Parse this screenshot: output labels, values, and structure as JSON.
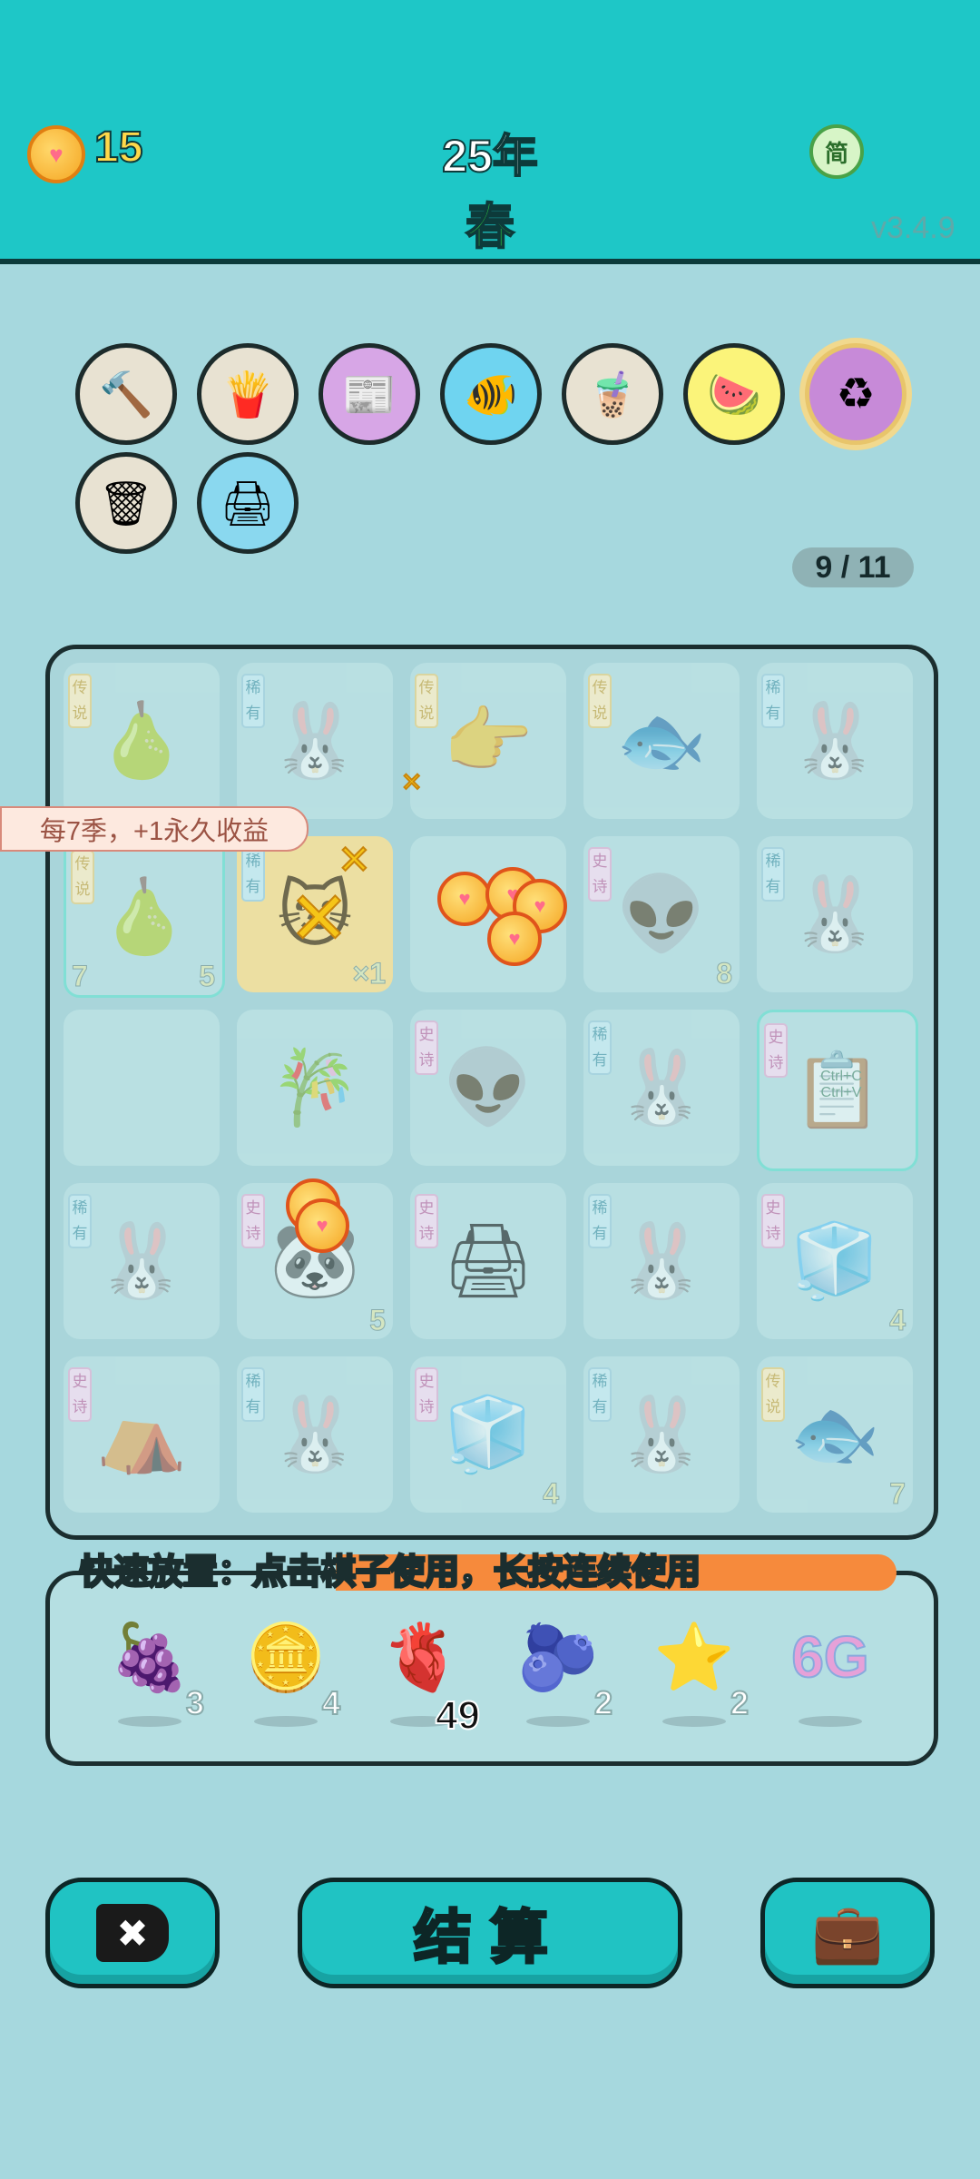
{
  "header": {
    "coins": "15",
    "year": "25年",
    "season": "春",
    "lang_button": "简",
    "version": "v3.4.9"
  },
  "relics": {
    "items": [
      "hammer",
      "fries",
      "time-magazine",
      "fish-bowl",
      "bubble-tea",
      "fruit-basket",
      "recycle",
      "trash-bag",
      "printer"
    ],
    "progress": "9 / 11"
  },
  "board": {
    "tooltip": "每7季，+1永久收益",
    "rows": [
      [
        {
          "art": "🍐",
          "tag": "传说",
          "tag_color": "yellow"
        },
        {
          "art": "🐰",
          "tag": "稀有",
          "tag_color": "blue"
        },
        {
          "art": "👉",
          "tag": "传说",
          "tag_color": "yellow"
        },
        {
          "art": "🐟",
          "tag": "传说",
          "tag_color": "yellow"
        },
        {
          "art": "🐰",
          "tag": "稀有",
          "tag_color": "blue"
        }
      ],
      [
        {
          "art": "🍐",
          "tag": "传说",
          "tag_color": "yellow",
          "num_left": "7",
          "num": "5"
        },
        {
          "art": "🐱",
          "tag": "稀有",
          "tag_color": "blue",
          "num": "×1"
        },
        {
          "art": "",
          "tag": "",
          "tag_color": ""
        },
        {
          "art": "👽",
          "tag": "史诗",
          "tag_color": "purple",
          "num": "8"
        },
        {
          "art": "🐰",
          "tag": "稀有",
          "tag_color": "blue"
        }
      ],
      [
        {
          "art": "",
          "tag": "",
          "tag_color": ""
        },
        {
          "art": "🎋",
          "tag": "",
          "tag_color": ""
        },
        {
          "art": "👽",
          "tag": "史诗",
          "tag_color": "purple"
        },
        {
          "art": "🐰",
          "tag": "稀有",
          "tag_color": "blue"
        },
        {
          "art": "📋",
          "tag": "史诗",
          "tag_color": "purple",
          "sub": "Ctrl+C Ctrl+V"
        }
      ],
      [
        {
          "art": "🐰",
          "tag": "稀有",
          "tag_color": "blue"
        },
        {
          "art": "🐼",
          "tag": "史诗",
          "tag_color": "purple",
          "num": "5"
        },
        {
          "art": "🖨",
          "tag": "史诗",
          "tag_color": "purple"
        },
        {
          "art": "🐰",
          "tag": "稀有",
          "tag_color": "blue"
        },
        {
          "art": "🧊",
          "tag": "史诗",
          "tag_color": "purple",
          "num": "4"
        }
      ],
      [
        {
          "art": "⛺",
          "tag": "史诗",
          "tag_color": "purple"
        },
        {
          "art": "🐰",
          "tag": "稀有",
          "tag_color": "blue"
        },
        {
          "art": "🧊",
          "tag": "史诗",
          "tag_color": "purple",
          "num": "4"
        },
        {
          "art": "🐰",
          "tag": "稀有",
          "tag_color": "blue"
        },
        {
          "art": "🐟",
          "tag": "传说",
          "tag_color": "yellow",
          "num": "7"
        }
      ]
    ]
  },
  "tray": {
    "banner": "快速放置：点击棋子使用，长按连续使用",
    "items": [
      {
        "icon": "lychee",
        "glyph": "🍇",
        "count": "3"
      },
      {
        "icon": "dollar-coin",
        "glyph": "🪙",
        "count": "4"
      },
      {
        "icon": "liver",
        "glyph": "🫀",
        "count": "49"
      },
      {
        "icon": "blueberry",
        "glyph": "🫐",
        "count": "2"
      },
      {
        "icon": "star",
        "glyph": "⭐",
        "count": "2"
      },
      {
        "icon": "6g",
        "glyph": "6G",
        "count": ""
      }
    ]
  },
  "actions": {
    "delete_icon": "✖",
    "settle_label": "结算",
    "bag_icon": "💼"
  },
  "colors": {
    "header_bg": "#1ec7c7",
    "page_bg": "#a6d8de",
    "accent_orange": "#f68a3c",
    "coin_gold": "#ffd84a",
    "season_green": "#2ecc40"
  }
}
